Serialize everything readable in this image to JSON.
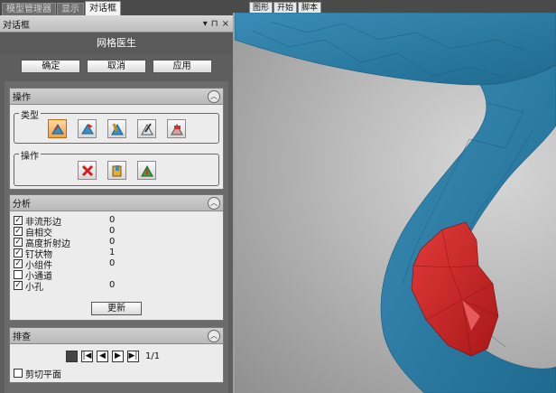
{
  "left_tabs": [
    "模型管理器",
    "显示",
    "对话框"
  ],
  "panel": {
    "title": "对话框",
    "controls": [
      "▾",
      "⊓",
      "×"
    ],
    "dialog_title": "网格医生",
    "buttons": [
      "确定",
      "取消",
      "应用"
    ]
  },
  "sections": {
    "operation": {
      "title": "操作",
      "type_group_label": "类型",
      "ops_group_label": "操作",
      "type_icons": [
        "auto-fix-icon",
        "flag-icon",
        "select-icon",
        "pen-icon",
        "eraser-icon"
      ],
      "op_icons": [
        "delete-icon",
        "fill-icon",
        "apply-icon"
      ]
    },
    "analysis": {
      "title": "分析",
      "items": [
        {
          "label": "非流形边",
          "checked": true,
          "value": "0"
        },
        {
          "label": "自相交",
          "checked": true,
          "value": "0"
        },
        {
          "label": "高度折射边",
          "checked": true,
          "value": "0"
        },
        {
          "label": "钉状物",
          "checked": true,
          "value": "1"
        },
        {
          "label": "小组件",
          "checked": true,
          "value": "0"
        },
        {
          "label": "小通道",
          "checked": false,
          "value": ""
        },
        {
          "label": "小孔",
          "checked": true,
          "value": "0"
        }
      ],
      "update_button": "更新"
    },
    "review": {
      "title": "排查",
      "page": "1/1",
      "clip_label": "剪切平面",
      "clip_checked": false
    }
  },
  "right_tabs": [
    "图形",
    "开始",
    "脚本"
  ],
  "colors": {
    "mesh_blue": "#2f7fa6",
    "defect_red": "#d52a2a",
    "selected_tool": "#f3a14a"
  }
}
